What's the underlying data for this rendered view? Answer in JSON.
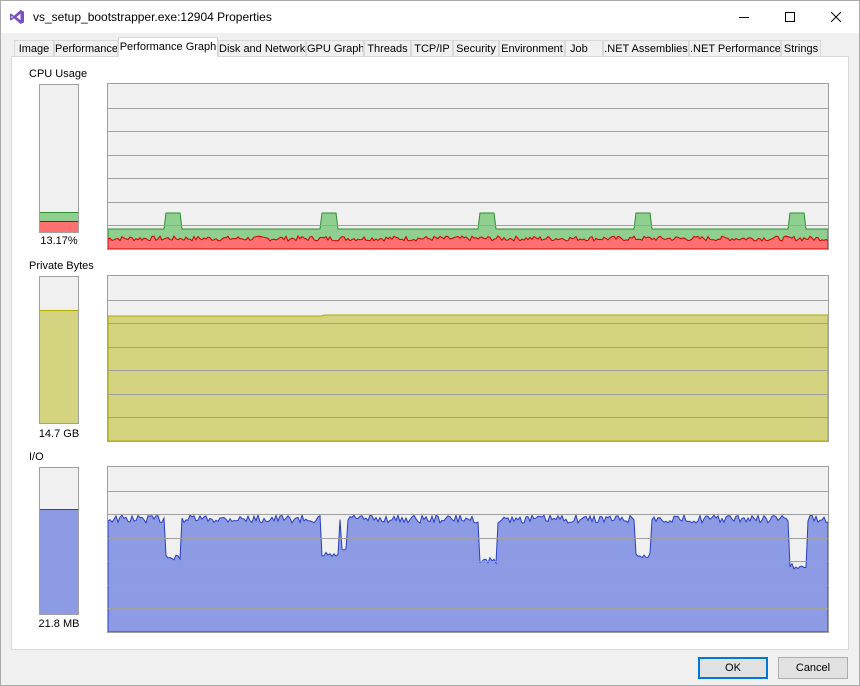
{
  "window": {
    "title": "vs_setup_bootstrapper.exe:12904 Properties",
    "app_icon": "visual-studio-icon",
    "controls": {
      "minimize": "minimize-icon",
      "maximize": "maximize-icon",
      "close": "close-icon"
    }
  },
  "tabs": [
    {
      "label": "Image",
      "active": false
    },
    {
      "label": "Performance",
      "active": false
    },
    {
      "label": "Performance Graph",
      "active": true
    },
    {
      "label": "Disk and Network",
      "active": false
    },
    {
      "label": "GPU Graph",
      "active": false
    },
    {
      "label": "Threads",
      "active": false
    },
    {
      "label": "TCP/IP",
      "active": false
    },
    {
      "label": "Security",
      "active": false
    },
    {
      "label": "Environment",
      "active": false
    },
    {
      "label": "Job",
      "active": false
    },
    {
      "label": ".NET Assemblies",
      "active": false
    },
    {
      "label": ".NET Performance",
      "active": false
    },
    {
      "label": "Strings",
      "active": false
    }
  ],
  "sections": {
    "cpu": {
      "label": "CPU Usage",
      "value": "13.17%",
      "meter_total_fraction": 0.13,
      "meter_kernel_fraction": 0.07,
      "colors": {
        "user": "#8fcf8f",
        "user_line": "#2e8b2e",
        "kernel": "#ff7070",
        "kernel_line": "#d00000"
      }
    },
    "private_bytes": {
      "label": "Private Bytes",
      "value": "14.7 GB",
      "meter_fraction": 0.77,
      "colors": {
        "fill": "#d4d480",
        "line": "#b0a800"
      }
    },
    "io": {
      "label": "I/O",
      "value": "21.8  MB",
      "meter_fraction": 0.71,
      "colors": {
        "fill": "#8c9be3",
        "line": "#2a3ec0"
      }
    }
  },
  "buttons": {
    "ok": "OK",
    "cancel": "Cancel"
  }
}
